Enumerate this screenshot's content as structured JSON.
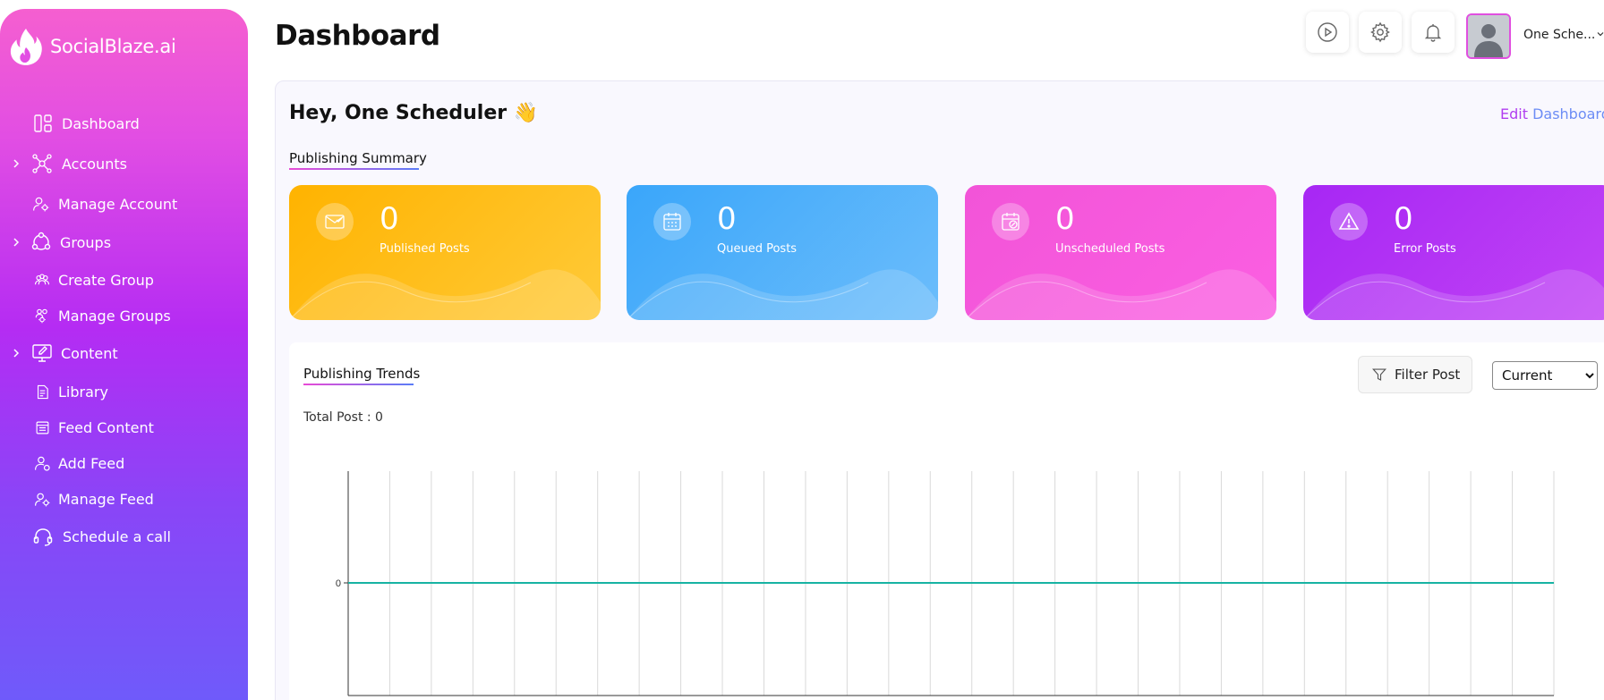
{
  "brand": {
    "name": "SocialBlaze.ai",
    "logo_icon": "flame-logo-icon"
  },
  "sidebar": {
    "items": [
      {
        "label": "Dashboard",
        "icon": "dashboard-icon",
        "expandable": false
      },
      {
        "label": "Accounts",
        "icon": "network-icon",
        "expandable": true
      },
      {
        "label": "Manage Account",
        "icon": "user-gear-icon",
        "expandable": false
      },
      {
        "label": "Groups",
        "icon": "group-circle-icon",
        "expandable": true
      },
      {
        "label": "Create Group",
        "icon": "create-group-icon",
        "expandable": false
      },
      {
        "label": "Manage Groups",
        "icon": "manage-groups-icon",
        "expandable": false
      },
      {
        "label": "Content",
        "icon": "monitor-edit-icon",
        "expandable": true
      },
      {
        "label": "Library",
        "icon": "library-doc-icon",
        "expandable": false
      },
      {
        "label": "Feed Content",
        "icon": "feed-list-icon",
        "expandable": false
      },
      {
        "label": "Add Feed",
        "icon": "user-plus-icon",
        "expandable": false
      },
      {
        "label": "Manage Feed",
        "icon": "user-settings-icon",
        "expandable": false
      },
      {
        "label": "Schedule a call",
        "icon": "headset-icon",
        "expandable": false
      }
    ]
  },
  "header": {
    "title": "Dashboard",
    "buttons": [
      "play-icon",
      "gear-icon",
      "bell-icon"
    ],
    "user_name": "One Sche..."
  },
  "main": {
    "greeting": "Hey, One Scheduler 👋",
    "edit_word": "Edit",
    "dashboard_word": "Dashboard",
    "summary_label": "Publishing Summary",
    "cards": [
      {
        "value": "0",
        "label": "Published Posts",
        "icon": "envelope-check-icon",
        "color": "#ffb300"
      },
      {
        "value": "0",
        "label": "Queued Posts",
        "icon": "calendar-grid-icon",
        "color": "#3aa6fa"
      },
      {
        "value": "0",
        "label": "Unscheduled Posts",
        "icon": "calendar-edit-icon",
        "color": "#f254d8"
      },
      {
        "value": "0",
        "label": "Error Posts",
        "icon": "warning-triangle-icon",
        "color": "#a727f4"
      }
    ],
    "trends_label": "Publishing Trends",
    "filter_label": "Filter Post",
    "period_selected": "Current",
    "total_post": "Total Post : 0"
  },
  "chart_data": {
    "type": "line",
    "series": [
      {
        "values": [
          0,
          0,
          0,
          0,
          0,
          0,
          0,
          0,
          0,
          0,
          0,
          0,
          0,
          0,
          0,
          0,
          0,
          0,
          0,
          0,
          0,
          0,
          0,
          0,
          0,
          0,
          0,
          0,
          0,
          0
        ],
        "color": "#17b3a3"
      }
    ],
    "yticks": [
      "0"
    ],
    "grid": true,
    "legend": "none"
  }
}
